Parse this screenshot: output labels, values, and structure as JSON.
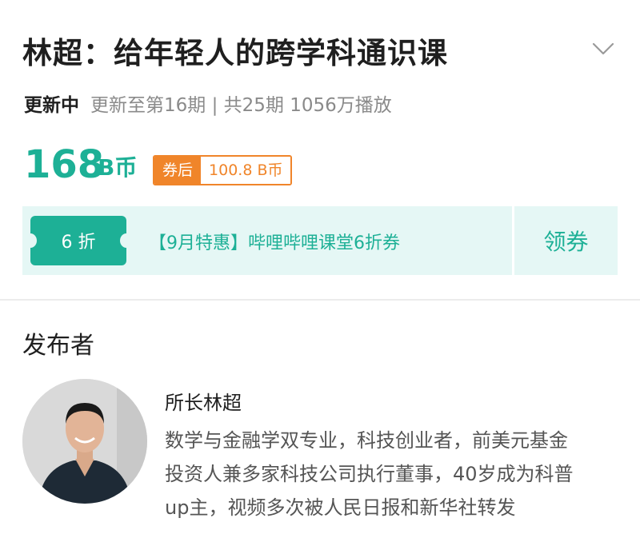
{
  "course": {
    "title": "林超：给年轻人的跨学科通识课",
    "status": "更新中",
    "meta": "更新至第16期 | 共25期  1056万播放"
  },
  "price": {
    "amount": "168",
    "unit": "B币",
    "coupon_label": "券后",
    "coupon_price": "100.8 B币"
  },
  "coupon_banner": {
    "ticket_label": "6 折",
    "text": "【9月特惠】哔哩哔哩课堂6折券",
    "claim_label": "领券"
  },
  "publisher": {
    "heading": "发布者",
    "name": "所长林超",
    "bio_lines": [
      "数学与金融学双专业，科技创业者，前美元基金",
      "投资人兼多家科技公司执行董事，40岁成为科普",
      "up主，视频多次被人民日报和新华社转发"
    ]
  },
  "colors": {
    "accent": "#1db096",
    "coupon_orange": "#f0852a",
    "banner_bg": "#e5f7f5"
  },
  "icons": {
    "expand": "chevron-down-icon",
    "avatar": "avatar-photo"
  }
}
